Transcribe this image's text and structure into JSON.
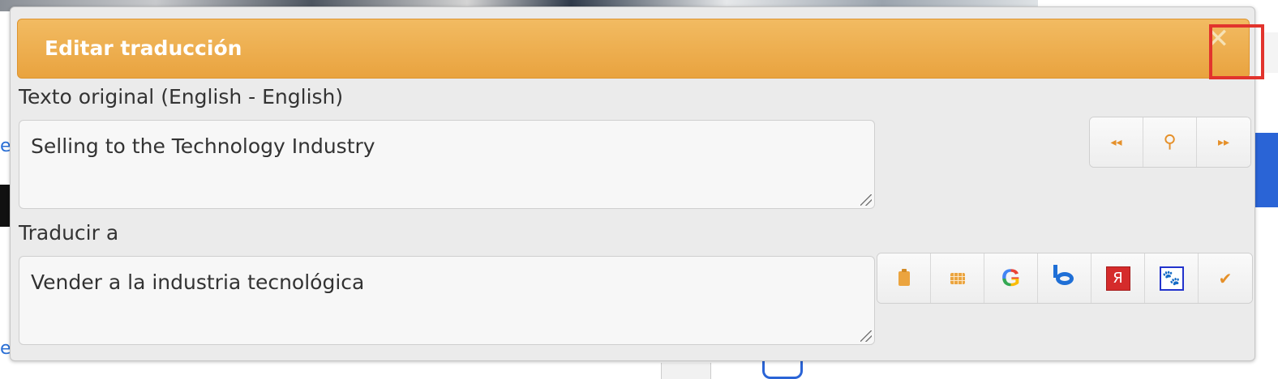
{
  "dialog": {
    "title": "Editar traducción",
    "close_icon": "close-icon",
    "original": {
      "label": "Texto original (English - English)",
      "value": "Selling to the Technology Industry"
    },
    "translate": {
      "label": "Traducir a",
      "value": "Vender a la industria tecnológica"
    },
    "nav_buttons": [
      {
        "icon": "previous-icon",
        "glyph": "◂◂"
      },
      {
        "icon": "search-icon",
        "glyph": "⚲"
      },
      {
        "icon": "next-icon",
        "glyph": "▸▸"
      }
    ],
    "tool_buttons": [
      {
        "icon": "clipboard-icon"
      },
      {
        "icon": "table-icon"
      },
      {
        "icon": "google-icon",
        "glyph": "G"
      },
      {
        "icon": "bing-icon"
      },
      {
        "icon": "yandex-icon",
        "glyph": "Я"
      },
      {
        "icon": "baidu-icon",
        "glyph": "🐾"
      },
      {
        "icon": "checkmark-icon",
        "glyph": "✔"
      }
    ]
  },
  "colors": {
    "titlebar": "#eba63f",
    "accent": "#e5902a",
    "highlight_border": "#e2342d"
  }
}
